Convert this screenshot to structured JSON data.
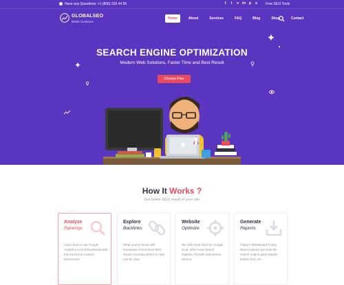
{
  "topbar": {
    "phone_text": "Have any Questions: +1 (800) 333 44 55",
    "social_icons": [
      "facebook-icon",
      "twitter-icon",
      "vimeo-icon",
      "linkedin-icon",
      "pinterest-icon",
      "skype-icon"
    ],
    "social_glyphs": [
      "f",
      "t",
      "v",
      "in",
      "p",
      "s"
    ],
    "tools_link": "Free SEO Tools"
  },
  "brand": {
    "name": "GLOBALSEO",
    "tagline": "Better Solutions"
  },
  "nav": {
    "items": [
      {
        "label": "Home",
        "active": true
      },
      {
        "label": "About"
      },
      {
        "label": "Services"
      },
      {
        "label": "FAQ"
      },
      {
        "label": "Blog"
      },
      {
        "label": "Shop"
      },
      {
        "label": "Contact"
      }
    ]
  },
  "hero": {
    "title": "SEARCH ENGINE OPTIMIZATION",
    "subtitle": "Modern Web Solutions, Faster Time and Best Result",
    "cta_label": "Choose Plan"
  },
  "how": {
    "title_main": "How It ",
    "title_accent": "Works ?",
    "subtitle": "Get better SEO result of your site",
    "cards": [
      {
        "title": "Analyze",
        "subtitle": "Rankings",
        "icon": "magnifier-icon",
        "description": "Learn how to use Google Analytics to its full potential with this tutorial on custom dimensions."
      },
      {
        "title": "Explore",
        "subtitle": "Backlinks",
        "icon": "link-icon",
        "description": "When you're faced with thousands of technical SEO issues, knowing where to start can be vital."
      },
      {
        "title": "Website",
        "subtitle": "Optimize",
        "icon": "crosshair-icon",
        "description": "We offer local SEO for Google local, other local search engines, Provide submission service."
      },
      {
        "title": "Generate",
        "subtitle": "Reports",
        "icon": "download-icon",
        "description": "Today's Whiteboard Friday, Rand explains just how the search engine giant weighs hidden from JS."
      }
    ]
  },
  "colors": {
    "hero_bg": "#5a36c0",
    "accent": "#e94b5e",
    "heading": "#2f3144",
    "muted": "#9a9aab"
  }
}
